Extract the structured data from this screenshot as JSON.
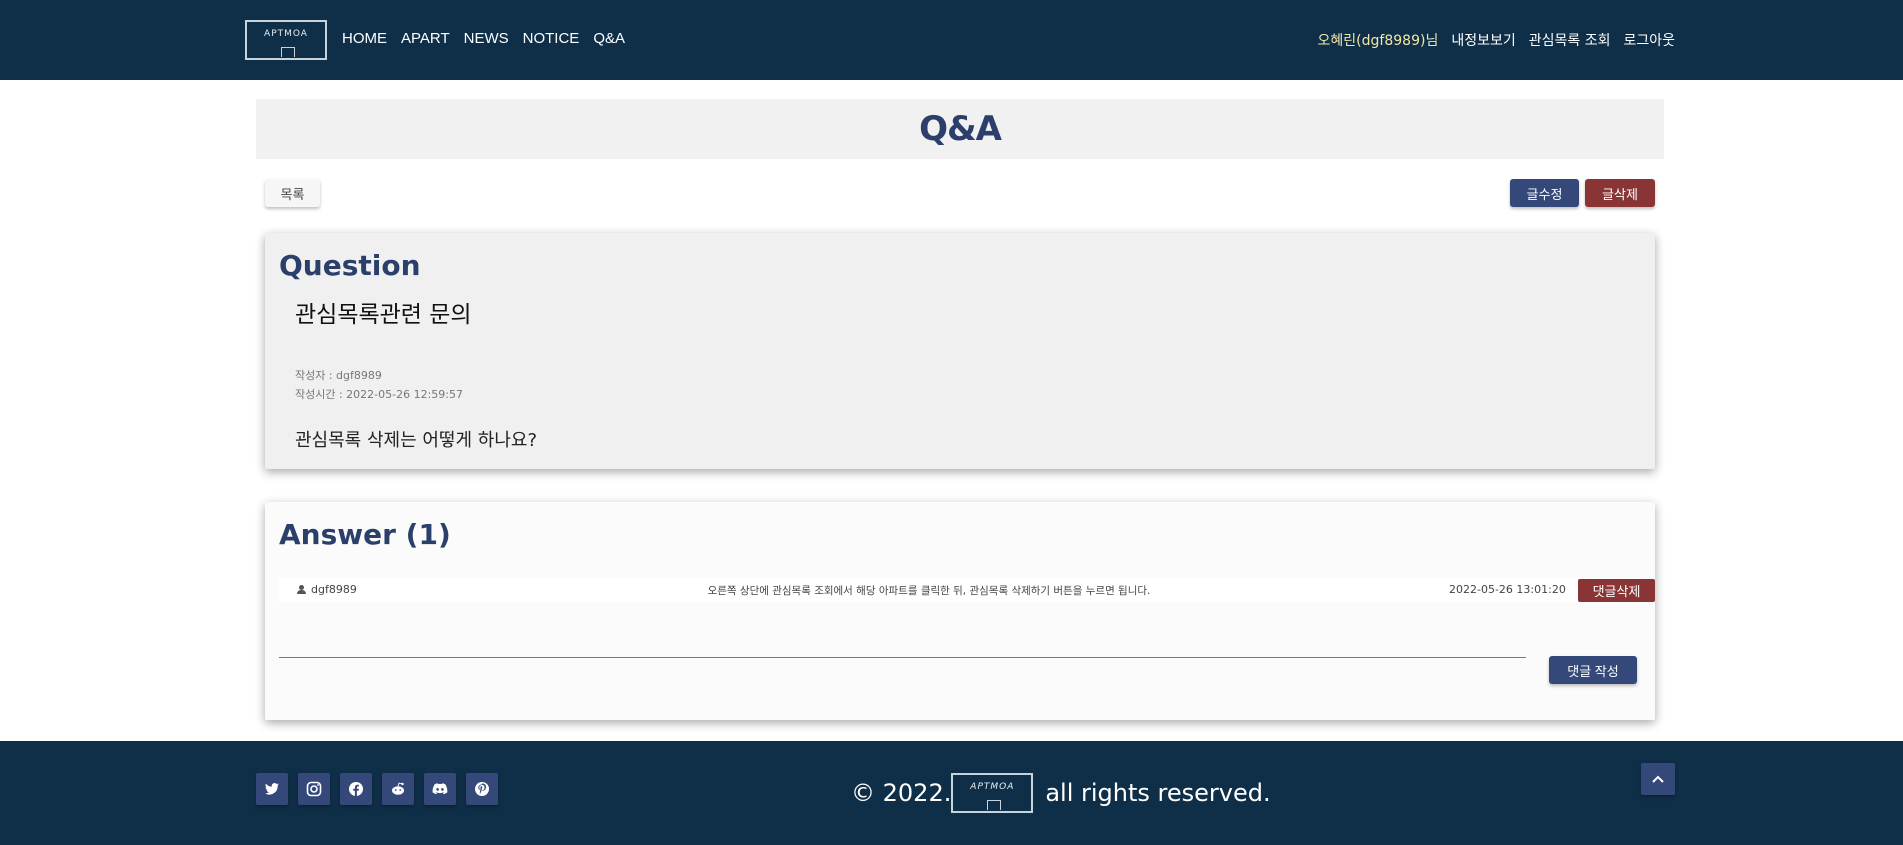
{
  "header": {
    "logo_text": "APTMOA",
    "nav": [
      "HOME",
      "APART",
      "NEWS",
      "NOTICE",
      "Q&A"
    ],
    "user_name": "오혜린(dgf8989)님",
    "user_links": [
      "내정보보기",
      "관심목록 조회",
      "로그아웃"
    ]
  },
  "page": {
    "title": "Q&A",
    "list_button": "목록",
    "edit_button": "글수정",
    "delete_button": "글삭제"
  },
  "question": {
    "section_title": "Question",
    "subject": "관심목록관련 문의",
    "author": "작성자 : dgf8989",
    "time": "작성시간 : 2022-05-26 12:59:57",
    "body": "관심목록 삭제는 어떻게 하나요?"
  },
  "answer": {
    "section_title": "Answer (1)",
    "comments": [
      {
        "author": "dgf8989",
        "text": "오른쪽 상단에 관심목록 조회에서 해당 아파트를 클릭한 뒤, 관심목록 삭제하기 버튼을 누르면 됩니다.",
        "time": "2022-05-26 13:01:20",
        "delete_label": "댓글삭제"
      }
    ],
    "comment_input_value": "",
    "write_button": "댓글 작성"
  },
  "footer": {
    "social_icons": [
      "twitter-icon",
      "instagram-icon",
      "facebook-icon",
      "reddit-icon",
      "discord-icon",
      "pinterest-icon"
    ],
    "copyright_prefix": "© 2022.",
    "logo_text": "APTMOA",
    "copyright_suffix": "all rights reserved."
  },
  "colors": {
    "header_bg": "#0f2f48",
    "primary": "#34497a",
    "danger": "#8a3535",
    "title_text": "#2b3f6b"
  }
}
